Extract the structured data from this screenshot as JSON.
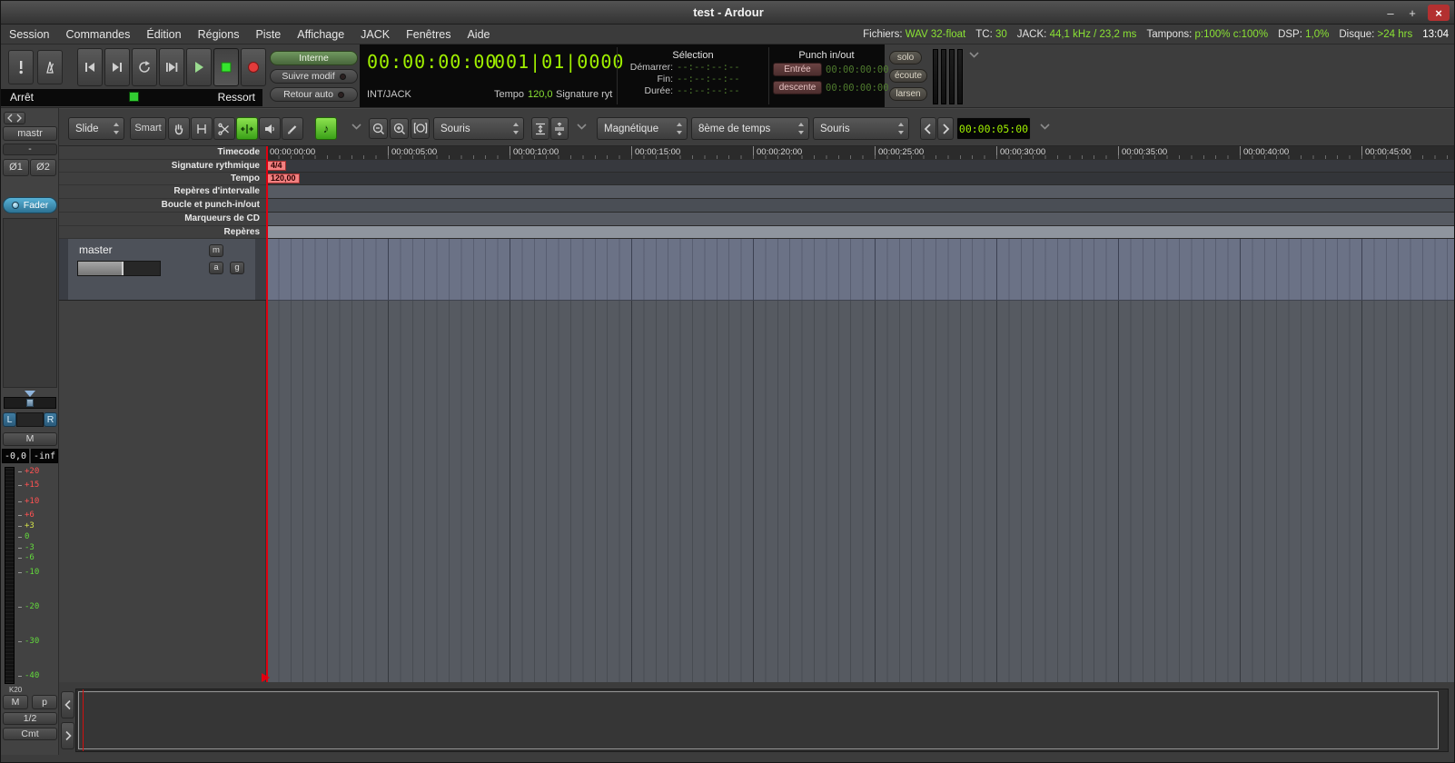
{
  "colors": {
    "clock_green": "#a0f000",
    "status_green": "#8ae234",
    "dim_clock_green": "#4f7a2e",
    "record_red": "#e23b3b",
    "transport_active_green": "#35e52e",
    "playhead_red": "#e00010",
    "marker_red": "#f28080",
    "fader_button_blue": "#3d8fb0",
    "tool_active_green": "#53c42c"
  },
  "window": {
    "title": "test - Ardour",
    "controls": {
      "minimize": "–",
      "maximize": "+",
      "close": "×"
    }
  },
  "menubar": {
    "items": [
      "Session",
      "Commandes",
      "Édition",
      "Régions",
      "Piste",
      "Affichage",
      "JACK",
      "Fenêtres",
      "Aide"
    ],
    "status": [
      {
        "label": "Fichiers:",
        "value": "WAV 32-float"
      },
      {
        "label": "TC:",
        "value": "30"
      },
      {
        "label": "JACK:",
        "value": "44,1 kHz / 23,2 ms"
      },
      {
        "label": "Tampons:",
        "value": "p:100% c:100%"
      },
      {
        "label": "DSP:",
        "value": "1,0%"
      },
      {
        "label": "Disque:",
        "value": ">24 hrs"
      }
    ],
    "clock": "13:04"
  },
  "transport": {
    "state_label": "Arrêt",
    "shuttle_mode": "Ressort",
    "sync_source": "Interne",
    "follow_edits": "Suivre modif",
    "auto_return": "Retour auto",
    "primary_clock": "00:00:00:00",
    "clock_source": "INT/JACK",
    "secondary_clock": "001|01|0000",
    "tempo_label": "Tempo",
    "tempo_value": "120,0",
    "meter_label": "Signature ryt",
    "selection": {
      "title": "Sélection",
      "start_label": "Démarrer:",
      "end_label": "Fin:",
      "length_label": "Durée:",
      "start": "--:--:--:--",
      "end": "--:--:--:--",
      "length": "--:--:--:--"
    },
    "punch": {
      "title": "Punch in/out",
      "in_label": "Entrée",
      "out_label": "descente",
      "in_time": "00:00:00:00",
      "out_time": "00:00:00:00"
    },
    "solo_label": "solo",
    "monitor_label": "écoute",
    "feedback_label": "larsen"
  },
  "toolbar": {
    "edit_mode": "Slide",
    "smart_label": "Smart",
    "zoom_focus": "Souris",
    "snap_mode": "Magnétique",
    "snap_unit": "8ème de temps",
    "edit_point": "Souris",
    "nudge_clock": "00:00:05:00",
    "note_icon": "♪"
  },
  "rulers": {
    "labels": [
      "Timecode",
      "Signature rythmique",
      "Tempo",
      "Repères d'intervalle",
      "Boucle et punch-in/out",
      "Marqueurs de CD",
      "Repères"
    ],
    "ticks": [
      "00:00:00:00",
      "00:00:05:00",
      "00:00:10:00",
      "00:00:15:00",
      "00:00:20:00",
      "00:00:25:00",
      "00:00:30:00",
      "00:00:35:00",
      "00:00:40:00",
      "00:00:45:00"
    ],
    "meter_marker": "4/4",
    "tempo_marker": "120,00"
  },
  "track": {
    "name": "master",
    "mute_label": "m",
    "amp_label": "a",
    "gain_label": "g"
  },
  "mixer_strip": {
    "name": "mastr",
    "group": "-",
    "input1": "Ø1",
    "input2": "Ø2",
    "fader_button": "Fader",
    "pan_left": "L",
    "pan_right": "R",
    "mute_label": "M",
    "gain_display": "-0,0",
    "peak_display": "-inf",
    "meter_scale": [
      "+20",
      "+15",
      "+10",
      "+6",
      "+3",
      "0",
      "-3",
      "-6",
      "-10",
      "-20",
      "-30",
      "-40"
    ],
    "meter_type": "K20",
    "metering_m": "M",
    "metering_p": "p",
    "channel_label": "1/2",
    "comments_label": "Cmt"
  }
}
